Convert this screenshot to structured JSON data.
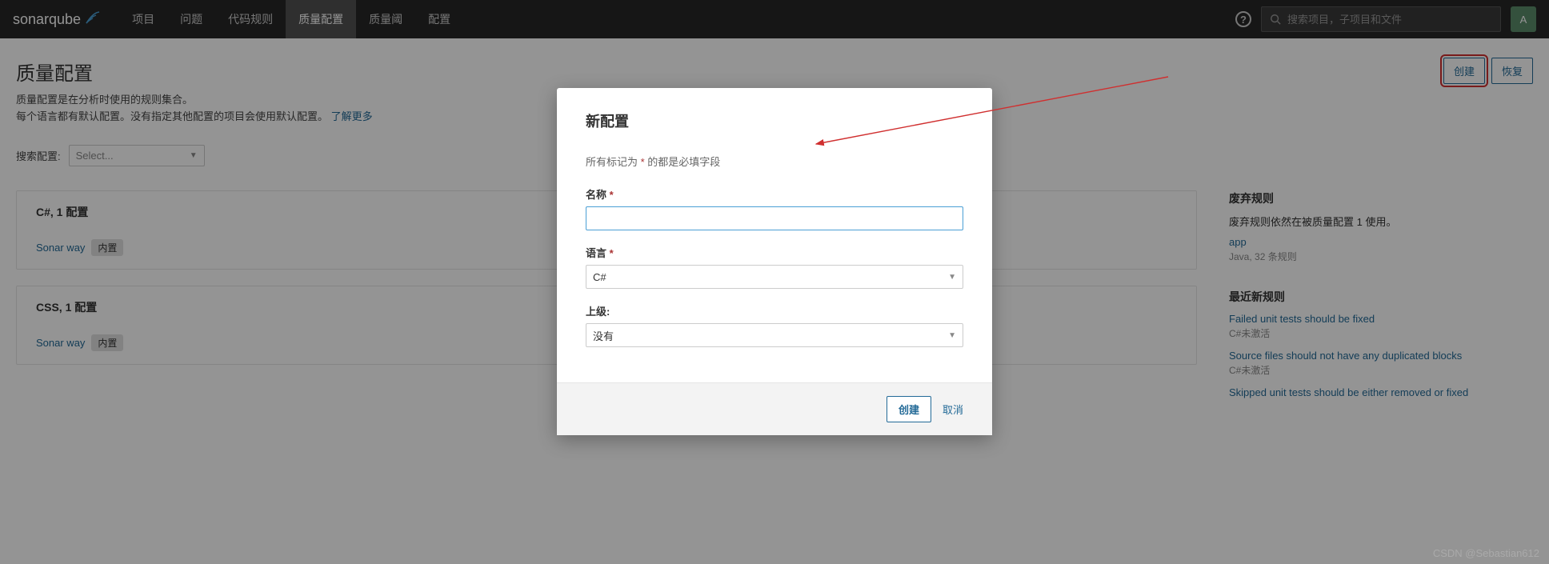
{
  "brand": "sonarqube",
  "nav": {
    "items": [
      {
        "label": "项目"
      },
      {
        "label": "问题"
      },
      {
        "label": "代码规则"
      },
      {
        "label": "质量配置",
        "active": true
      },
      {
        "label": "质量阈"
      },
      {
        "label": "配置"
      }
    ]
  },
  "topbar": {
    "search_placeholder": "搜索项目，子项目和文件",
    "user_initial": "A"
  },
  "page": {
    "title": "质量配置",
    "desc_line1": "质量配置是在分析时使用的规则集合。",
    "desc_line2_a": "每个语言都有默认配置。没有指定其他配置的项目会使用默认配置。 ",
    "desc_link": "了解更多",
    "create_btn": "创建",
    "restore_btn": "恢复",
    "search_label": "搜索配置:",
    "search_placeholder": "Select..."
  },
  "profiles": [
    {
      "title": "C#, 1 配置",
      "name": "Sonar way",
      "badge": "内置"
    },
    {
      "title": "CSS, 1 配置",
      "name": "Sonar way",
      "badge": "内置"
    }
  ],
  "sidebar": {
    "deprecated": {
      "title": "废弃规则",
      "text": "废弃规则依然在被质量配置 1 使用。",
      "link": "app",
      "meta": "Java, 32 条规则"
    },
    "recent": {
      "title": "最近新规则",
      "items": [
        {
          "link": "Failed unit tests should be fixed",
          "meta": "C#未激活"
        },
        {
          "link": "Source files should not have any duplicated blocks",
          "meta": "C#未激活"
        },
        {
          "link": "Skipped unit tests should be either removed or fixed",
          "meta": ""
        }
      ]
    }
  },
  "modal": {
    "title": "新配置",
    "note_a": "所有标记为 ",
    "note_b": " 的都是必填字段",
    "name_label": "名称",
    "lang_label": "语言",
    "lang_value": "C#",
    "parent_label": "上级:",
    "parent_value": "没有",
    "submit": "创建",
    "cancel": "取消"
  },
  "watermark": "CSDN @Sebastian612"
}
